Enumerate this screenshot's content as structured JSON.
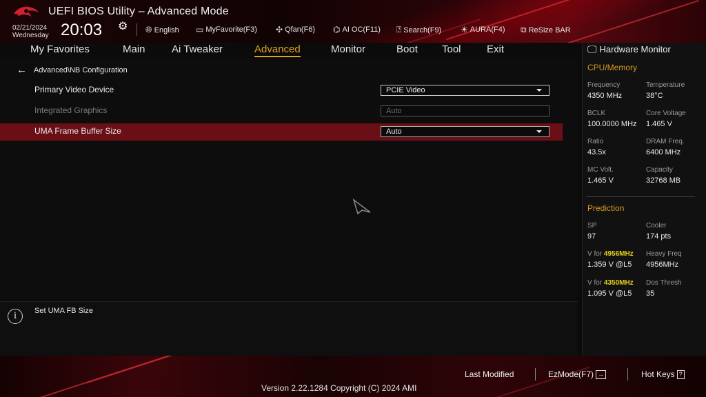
{
  "header": {
    "title": "UEFI BIOS Utility – Advanced Mode",
    "date": "02/21/2024",
    "weekday": "Wednesday",
    "time": "20:03",
    "toolbar": [
      {
        "label": "English",
        "icon": "globe-icon"
      },
      {
        "label": "MyFavorite(F3)",
        "icon": "favorite-icon"
      },
      {
        "label": "Qfan(F6)",
        "icon": "fan-icon"
      },
      {
        "label": "AI OC(F11)",
        "icon": "ai-chip-icon"
      },
      {
        "label": "Search(F9)",
        "icon": "search-icon"
      },
      {
        "label": "AURA(F4)",
        "icon": "aura-light-icon"
      },
      {
        "label": "ReSize BAR",
        "icon": "resize-bar-icon"
      }
    ]
  },
  "nav": {
    "tabs": [
      "My Favorites",
      "Main",
      "Ai Tweaker",
      "Advanced",
      "Monitor",
      "Boot",
      "Tool",
      "Exit"
    ],
    "active": "Advanced"
  },
  "main": {
    "breadcrumb": "Advanced\\NB Configuration",
    "settings": [
      {
        "label": "Primary Video Device",
        "value": "PCIE Video",
        "enabled": true,
        "highlighted": false
      },
      {
        "label": "Integrated Graphics",
        "value": "Auto",
        "enabled": false,
        "highlighted": false
      },
      {
        "label": "UMA Frame Buffer Size",
        "value": "Auto",
        "enabled": true,
        "highlighted": true
      }
    ]
  },
  "help": {
    "text": "Set UMA FB Size"
  },
  "hardware_monitor": {
    "title": "Hardware Monitor",
    "cpu_memory": {
      "heading": "CPU/Memory",
      "items": [
        {
          "label": "Frequency",
          "value": "4350 MHz"
        },
        {
          "label": "Temperature",
          "value": "38°C"
        },
        {
          "label": "BCLK",
          "value": "100.0000 MHz"
        },
        {
          "label": "Core Voltage",
          "value": "1.465 V"
        },
        {
          "label": "Ratio",
          "value": "43.5x"
        },
        {
          "label": "DRAM Freq.",
          "value": "6400 MHz"
        },
        {
          "label": "MC Volt.",
          "value": "1.465 V"
        },
        {
          "label": "Capacity",
          "value": "32768 MB"
        }
      ]
    },
    "prediction": {
      "heading": "Prediction",
      "sp_label": "SP",
      "sp_value": "97",
      "cooler_label": "Cooler",
      "cooler_value": "174 pts",
      "v_prefix": "V for",
      "v1_freq": "4956MHz",
      "v1_value": "1.359 V @L5",
      "heavy_label": "Heavy Freq",
      "heavy_value": "4956MHz",
      "v2_freq": "4350MHz",
      "v2_value": "1.095 V @L5",
      "dos_label": "Dos Thresh",
      "dos_value": "35"
    }
  },
  "footer": {
    "last_modified": "Last Modified",
    "ezmode": "EzMode(F7)",
    "ezmode_key": "→",
    "hot_keys": "Hot Keys",
    "hot_keys_key": "?",
    "version": "Version 2.22.1284 Copyright (C) 2024 AMI"
  },
  "colors": {
    "accent": "#e3a21a",
    "highlight_row": "#6a0f16",
    "prediction_highlight": "#e6d21a"
  }
}
